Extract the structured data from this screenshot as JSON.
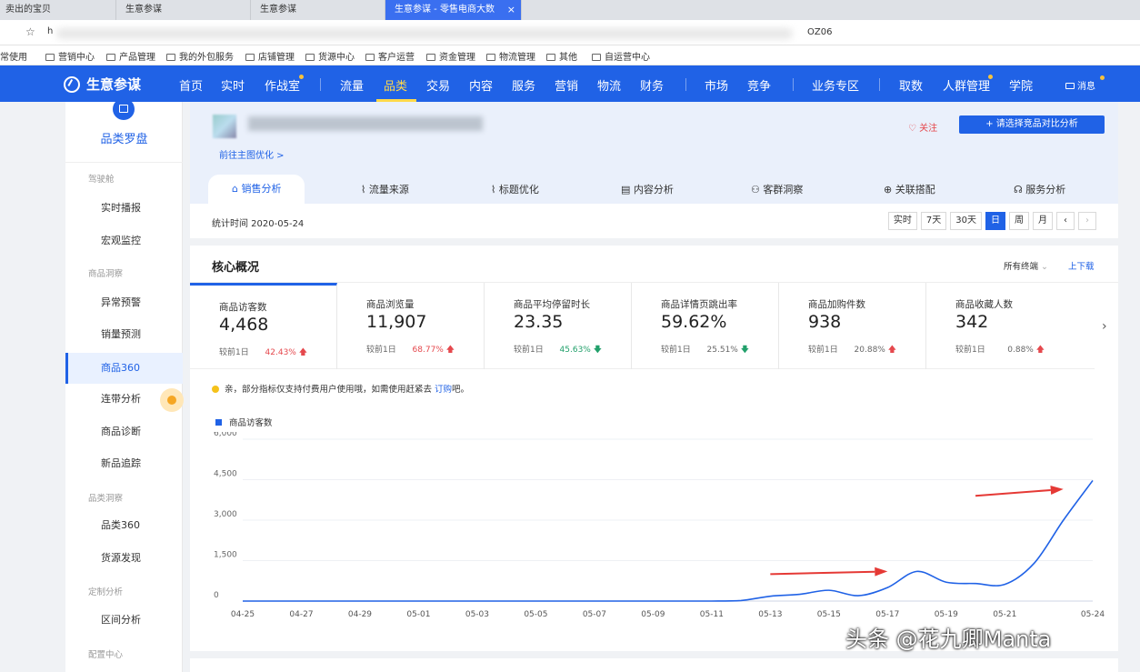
{
  "browser": {
    "tabs": [
      {
        "label": "卖出的宝贝"
      },
      {
        "label": "生意参谋"
      },
      {
        "label": "生意参谋"
      },
      {
        "label": "生意参谋 - 零售电商大数",
        "active": true
      }
    ],
    "close_glyph": "×",
    "url_prefix": "h",
    "url_tail": "OZ06",
    "bookmarks": [
      "常使用",
      "营销中心",
      "产品管理",
      "我的外包服务",
      "店铺管理",
      "货源中心",
      "客户运营",
      "资金管理",
      "物流管理",
      "其他",
      "自运营中心"
    ]
  },
  "nav": {
    "logo": "生意参谋",
    "items": [
      "首页",
      "实时",
      "作战室",
      "流量",
      "品类",
      "交易",
      "内容",
      "服务",
      "营销",
      "物流",
      "财务",
      "市场",
      "竞争",
      "业务专区",
      "取数",
      "人群管理",
      "学院"
    ],
    "active": "品类",
    "message": "消息",
    "accent": "#2062e6",
    "active_color": "#ffd94a"
  },
  "sidebar": {
    "title": "品类罗盘",
    "groups": [
      {
        "label": "驾驶舱",
        "items": [
          "实时播报",
          "宏观监控"
        ]
      },
      {
        "label": "商品洞察",
        "items": [
          "异常预警",
          "销量预测",
          "商品360",
          "连带分析",
          "商品诊断",
          "新品追踪"
        ]
      },
      {
        "label": "品类洞察",
        "items": [
          "品类360",
          "货源发现"
        ]
      },
      {
        "label": "定制分析",
        "items": [
          "区间分析"
        ]
      },
      {
        "label": "配置中心",
        "items": []
      }
    ],
    "active_item": "商品360"
  },
  "product": {
    "opt_link": "前往主图优化 >",
    "follow": "关注",
    "compare_button": "请选择竞品对比分析"
  },
  "subtabs": [
    "销售分析",
    "流量来源",
    "标题优化",
    "内容分析",
    "客群洞察",
    "关联搭配",
    "服务分析"
  ],
  "stats": {
    "date_text": "统计时间 2020-05-24",
    "periods": [
      "实时",
      "7天",
      "30天",
      "日",
      "周",
      "月"
    ],
    "active_period": "日"
  },
  "core": {
    "title": "核心概况",
    "selector": "所有终端",
    "download": "上下载",
    "compare_label": "较前1日",
    "metrics": [
      {
        "label": "商品访客数",
        "value": "4,468",
        "change": "42.43%",
        "dir": "up"
      },
      {
        "label": "商品浏览量",
        "value": "11,907",
        "change": "68.77%",
        "dir": "up"
      },
      {
        "label": "商品平均停留时长",
        "value": "23.35",
        "change": "45.63%",
        "dir": "down"
      },
      {
        "label": "商品详情页跳出率",
        "value": "59.62%",
        "change": "25.51%",
        "dir": "down"
      },
      {
        "label": "商品加购件数",
        "value": "938",
        "change": "20.88%",
        "dir": "up"
      },
      {
        "label": "商品收藏人数",
        "value": "342",
        "change": "0.88%",
        "dir": "up"
      }
    ],
    "notice_text": "亲，部分指标仅支持付费用户使用哦，如需使用赶紧去 ",
    "notice_link": "订购",
    "notice_tail": "吧。"
  },
  "watermark": "头条 @花九卿Manta",
  "chart_data": {
    "type": "line",
    "series": [
      {
        "name": "商品访客数",
        "color": "#2062e6",
        "x": [
          "04-25",
          "04-26",
          "04-27",
          "04-28",
          "04-29",
          "04-30",
          "05-01",
          "05-02",
          "05-03",
          "05-04",
          "05-05",
          "05-06",
          "05-07",
          "05-08",
          "05-09",
          "05-10",
          "05-11",
          "05-12",
          "05-13",
          "05-14",
          "05-15",
          "05-16",
          "05-17",
          "05-18",
          "05-19",
          "05-20",
          "05-21",
          "05-22",
          "05-23",
          "05-24"
        ],
        "values": [
          0,
          0,
          0,
          0,
          0,
          0,
          0,
          0,
          0,
          0,
          0,
          0,
          0,
          0,
          0,
          0,
          0,
          20,
          180,
          250,
          400,
          200,
          500,
          1100,
          700,
          650,
          620,
          1400,
          3000,
          4468
        ]
      }
    ],
    "x_ticks": [
      "04-25",
      "04-27",
      "04-29",
      "05-01",
      "05-03",
      "05-05",
      "05-07",
      "05-09",
      "05-11",
      "05-13",
      "05-15",
      "05-17",
      "05-19",
      "05-21",
      "05-24"
    ],
    "y_ticks": [
      "0",
      "1,500",
      "3,000",
      "4,500",
      "6,000"
    ],
    "ylim": [
      0,
      6000
    ],
    "grid": true,
    "annotations": [
      {
        "type": "arrow",
        "color": "#e53935",
        "from_x": "05-13",
        "from_value": 1000,
        "to_x": "05-17",
        "to_value": 1100
      },
      {
        "type": "arrow",
        "color": "#e53935",
        "from_x": "05-20",
        "from_value": 3900,
        "to_x": "05-23",
        "to_value": 4150
      }
    ]
  }
}
